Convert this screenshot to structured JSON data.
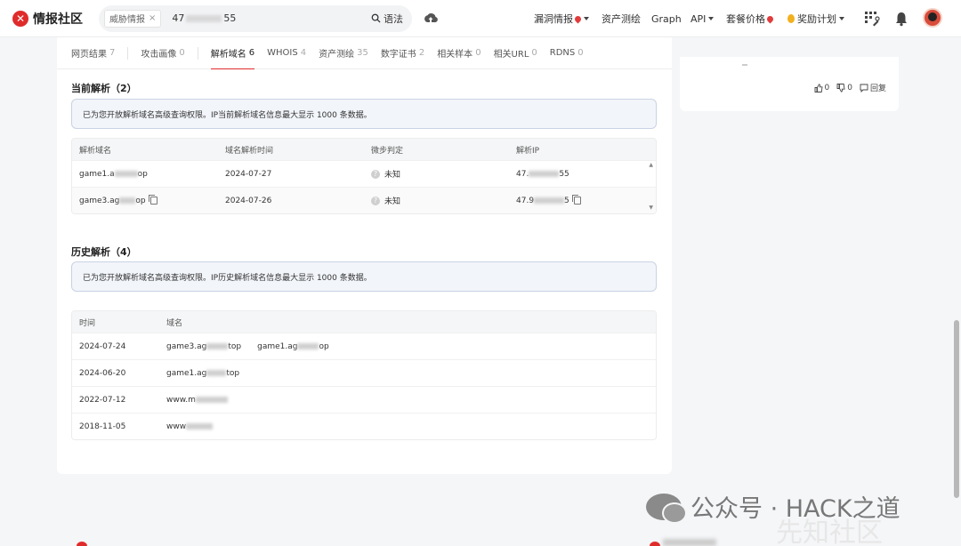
{
  "header": {
    "logo_text": "情报社区",
    "search": {
      "chip_label": "威胁情报",
      "chip_close": "×",
      "value_prefix": "47",
      "value_suffix": "55",
      "syntax_label": "语法"
    },
    "nav": {
      "vuln": "漏洞情报",
      "asset": "资产测绘",
      "graph": "Graph",
      "api": "API",
      "pricing": "套餐价格",
      "rewards": "奖励计划"
    }
  },
  "tabs": [
    {
      "label": "网页结果",
      "count": "7"
    },
    {
      "label": "攻击画像",
      "count": "0"
    },
    {
      "label": "解析域名",
      "count": "6",
      "active": true
    },
    {
      "label": "WHOIS",
      "count": "4"
    },
    {
      "label": "资产测绘",
      "count": "35"
    },
    {
      "label": "数字证书",
      "count": "2"
    },
    {
      "label": "相关样本",
      "count": "0"
    },
    {
      "label": "相关URL",
      "count": "0"
    },
    {
      "label": "RDNS",
      "count": "0"
    }
  ],
  "current": {
    "title": "当前解析（2）",
    "notice": "已为您开放解析域名高级查询权限。IP当前解析域名信息最大显示 1000 条数据。",
    "columns": [
      "解析域名",
      "域名解析时间",
      "微步判定",
      "解析IP"
    ],
    "rows": [
      {
        "domain_pre": "game1.a",
        "domain_post": "op",
        "date": "2024-07-27",
        "verdict": "未知",
        "ip_pre": "47.",
        "ip_post": "55"
      },
      {
        "domain_pre": "game3.ag",
        "domain_post": "op",
        "date": "2024-07-26",
        "verdict": "未知",
        "ip_pre": "47.9",
        "ip_post": "5"
      }
    ]
  },
  "history": {
    "title": "历史解析（4）",
    "notice": "已为您开放解析域名高级查询权限。IP历史解析域名信息最大显示 1000 条数据。",
    "columns": [
      "时间",
      "域名"
    ],
    "rows": [
      {
        "date": "2024-07-24",
        "d1_pre": "game3.ag",
        "d1_post": "top",
        "d2_pre": "game1.ag",
        "d2_post": "op"
      },
      {
        "date": "2024-06-20",
        "d1_pre": "game1.ag",
        "d1_post": "top"
      },
      {
        "date": "2022-07-12",
        "d1_pre": "www.m"
      },
      {
        "date": "2018-11-05",
        "d1_pre": "www"
      }
    ]
  },
  "side": {
    "like_count": "0",
    "dislike_count": "0",
    "reply_label": "回复"
  },
  "watermark": {
    "text": "公众号 · HACK之道",
    "back_text": "先知社区"
  }
}
